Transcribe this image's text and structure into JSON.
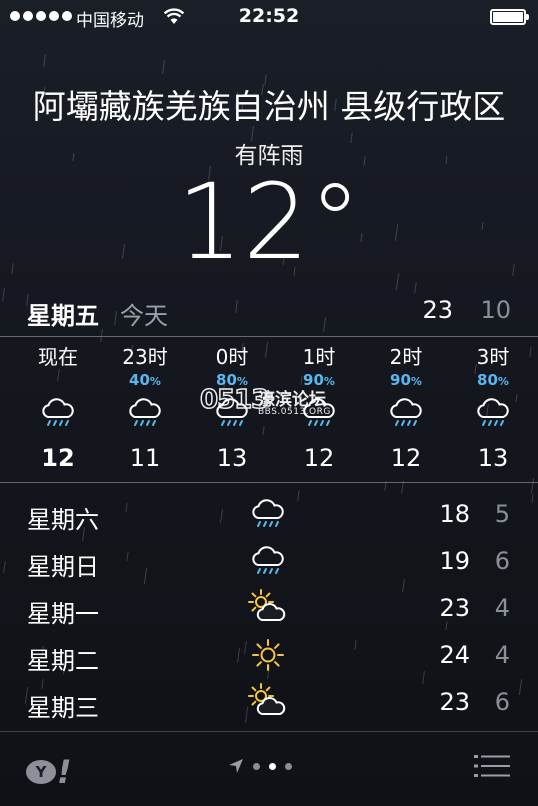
{
  "status": {
    "carrier": "中国移动",
    "time": "22:52"
  },
  "location": {
    "city": "阿壩藏族羌族自治州 县级行政区",
    "condition": "有阵雨",
    "temperature": "12°"
  },
  "today": {
    "day": "星期五",
    "label": "今天",
    "high": "23",
    "low": "10"
  },
  "hourly": [
    {
      "time": "现在",
      "precip": "",
      "icon": "rain-cloud-icon",
      "temp": "12"
    },
    {
      "time": "23时",
      "precip": "40",
      "icon": "rain-cloud-icon",
      "temp": "11"
    },
    {
      "time": "0时",
      "precip": "80",
      "icon": "rain-cloud-icon",
      "temp": "13"
    },
    {
      "time": "1时",
      "precip": "90",
      "icon": "rain-cloud-icon",
      "temp": "12"
    },
    {
      "time": "2时",
      "precip": "90",
      "icon": "rain-cloud-icon",
      "temp": "12"
    },
    {
      "time": "3时",
      "precip": "80",
      "icon": "rain-cloud-icon",
      "temp": "13"
    }
  ],
  "percent_sign": "%",
  "daily": [
    {
      "day": "星期六",
      "icon": "rain-cloud-icon",
      "high": "18",
      "low": "5"
    },
    {
      "day": "星期日",
      "icon": "rain-cloud-icon",
      "high": "19",
      "low": "6"
    },
    {
      "day": "星期一",
      "icon": "partly-cloudy-icon",
      "high": "23",
      "low": "4"
    },
    {
      "day": "星期二",
      "icon": "sun-icon",
      "high": "24",
      "low": "4"
    },
    {
      "day": "星期三",
      "icon": "partly-cloudy-icon",
      "high": "23",
      "low": "6"
    }
  ],
  "watermark": {
    "number": "0513",
    "name": "濠滨论坛",
    "url": "BBS.0513.ORG"
  },
  "footer": {
    "logo": "Y!",
    "active_page": 2
  },
  "colors": {
    "precip": "#5ab6ef",
    "rain_icon": "#5ab6ef",
    "sun": "#f5c542"
  }
}
